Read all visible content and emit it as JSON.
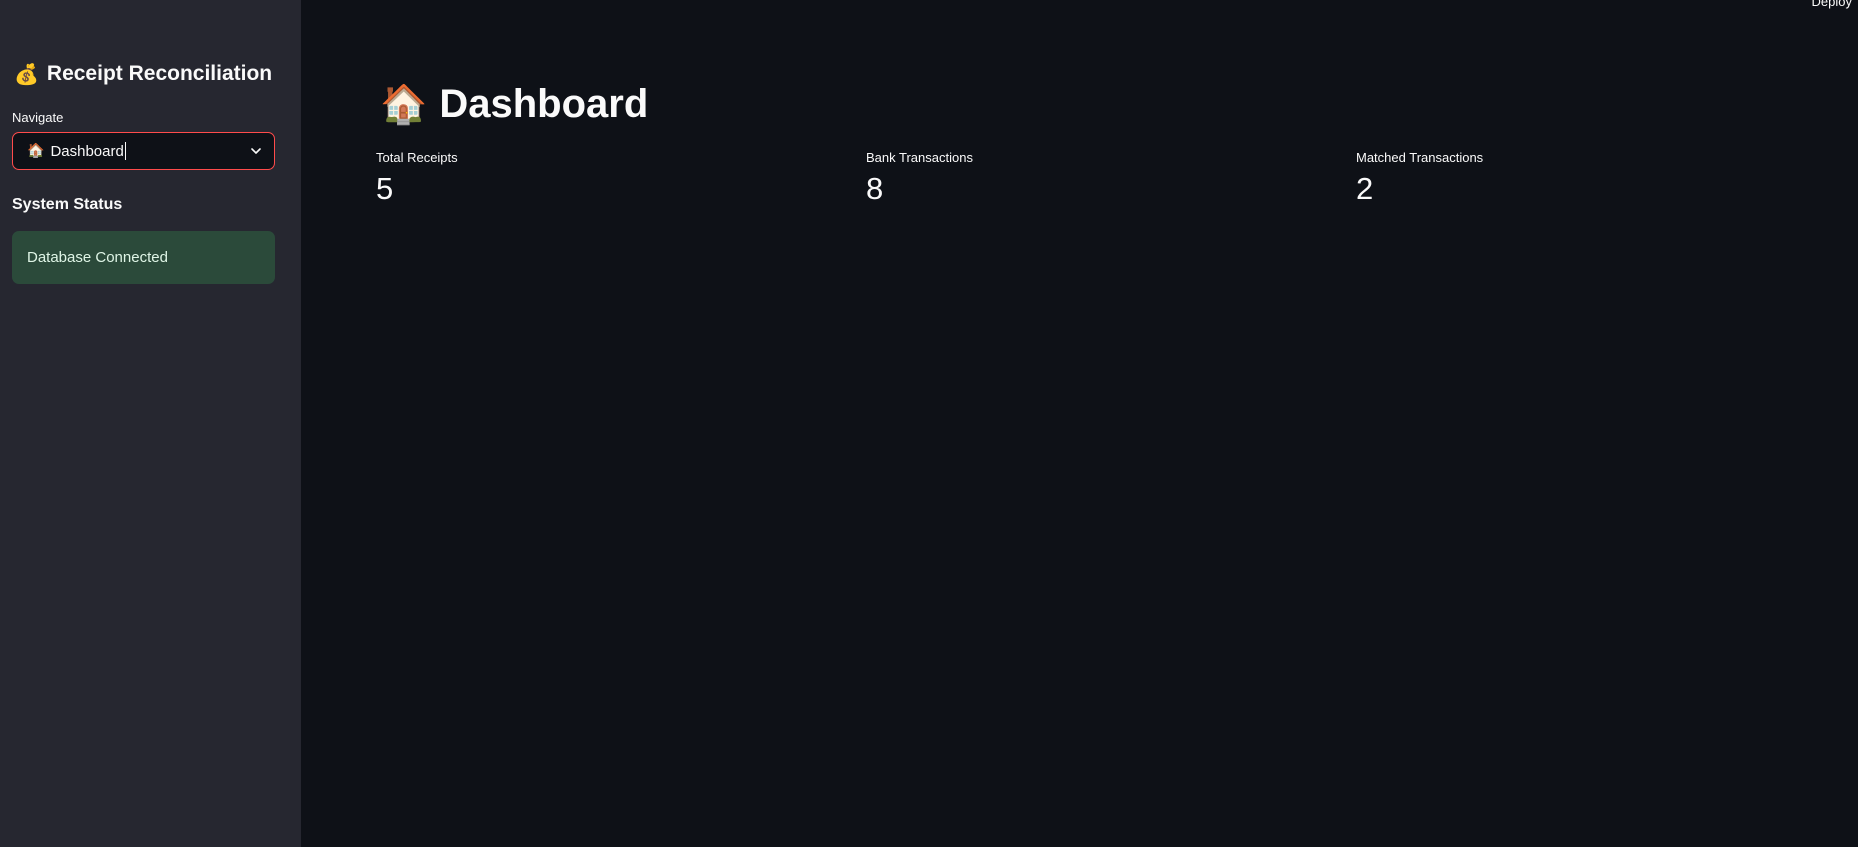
{
  "sidebar": {
    "title_icon": "💰",
    "title": "Receipt Reconciliation",
    "nav_label": "Navigate",
    "nav_selected_icon": "🏠",
    "nav_selected": "Dashboard",
    "status_heading": "System Status",
    "status_message": "Database Connected"
  },
  "header": {
    "deploy_label": "Deploy"
  },
  "main": {
    "title_icon": "🏠",
    "title": "Dashboard",
    "metrics": [
      {
        "label": "Total Receipts",
        "value": "5"
      },
      {
        "label": "Bank Transactions",
        "value": "8"
      },
      {
        "label": "Matched Transactions",
        "value": "2"
      }
    ]
  },
  "colors": {
    "main_bg": "#0e1117",
    "sidebar_bg": "#262730",
    "accent_border": "#ff4b4b",
    "success_bg": "#2b4a3a"
  }
}
